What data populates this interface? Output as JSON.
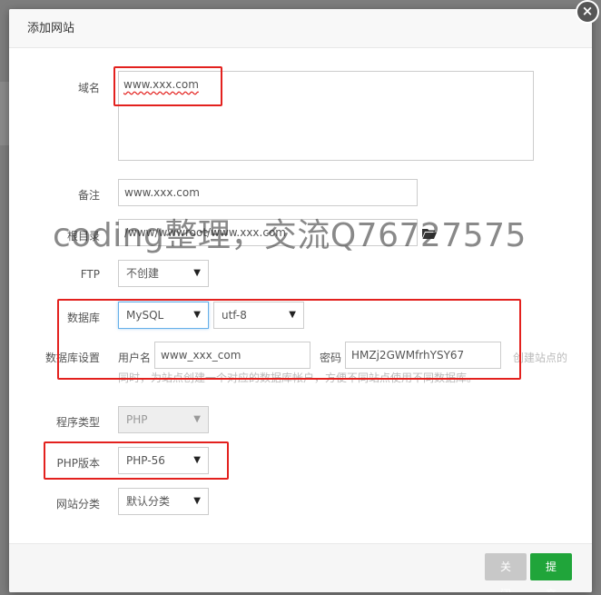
{
  "dialog": {
    "title": "添加网站",
    "close_symbol": "×"
  },
  "form": {
    "domain": {
      "label": "域名",
      "value": "www.xxx.com"
    },
    "remark": {
      "label": "备注",
      "value": "www.xxx.com"
    },
    "root": {
      "label": "根目录",
      "value": "/www/wwwroot/www.xxx.com",
      "icon": "folder-icon"
    },
    "ftp": {
      "label": "FTP",
      "selected": "不创建"
    },
    "database": {
      "label": "数据库",
      "selected": "MySQL",
      "charset": "utf-8"
    },
    "db_settings": {
      "label": "数据库设置",
      "user_label": "用户名",
      "user_value": "www_xxx_com",
      "password_label": "密码",
      "password_value": "HMZj2GWMfrhYSY67",
      "hint_right": "创建站点的",
      "hint_line2": "同时，为站点创建一个对应的数据库帐户，方便不同站点使用不同数据库。"
    },
    "program_type": {
      "label": "程序类型",
      "selected": "PHP"
    },
    "php_version": {
      "label": "PHP版本",
      "selected": "PHP-56"
    },
    "site_category": {
      "label": "网站分类",
      "selected": "默认分类"
    }
  },
  "watermark": "coding整理，交流Q76727575",
  "footer": {
    "close_label": "关闭",
    "submit_label": "提交"
  },
  "colors": {
    "accent_green": "#20a53a",
    "highlight_red": "#e3211e",
    "close_gray": "#c8c8c8"
  }
}
